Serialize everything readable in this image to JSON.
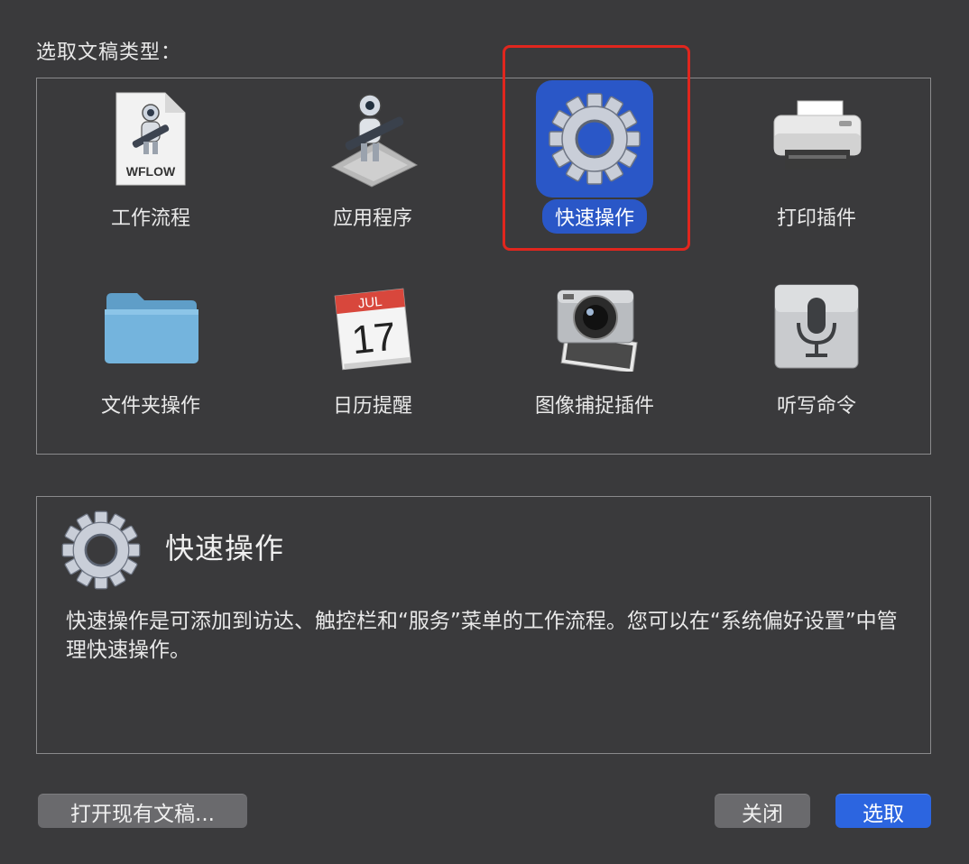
{
  "dialog": {
    "title": "选取文稿类型：",
    "highlight_color": "#e0261e",
    "selection_color": "#2a57c7"
  },
  "types": [
    {
      "label": "工作流程",
      "icon": "workflow-document-icon",
      "selected": false
    },
    {
      "label": "应用程序",
      "icon": "automator-robot-icon",
      "selected": false
    },
    {
      "label": "快速操作",
      "icon": "gear-icon",
      "selected": true
    },
    {
      "label": "打印插件",
      "icon": "printer-icon",
      "selected": false
    },
    {
      "label": "文件夹操作",
      "icon": "folder-icon",
      "selected": false
    },
    {
      "label": "日历提醒",
      "icon": "calendar-icon",
      "selected": false
    },
    {
      "label": "图像捕捉插件",
      "icon": "camera-icon",
      "selected": false
    },
    {
      "label": "听写命令",
      "icon": "microphone-icon",
      "selected": false
    }
  ],
  "workflow_badge": "WFLOW",
  "calendar": {
    "month": "JUL",
    "day": "17"
  },
  "description": {
    "title": "快速操作",
    "text": "快速操作是可添加到访达、触控栏和“服务”菜单的工作流程。您可以在“系统偏好设置”中管理快速操作。"
  },
  "buttons": {
    "open_existing": "打开现有文稿...",
    "close": "关闭",
    "choose": "选取"
  }
}
